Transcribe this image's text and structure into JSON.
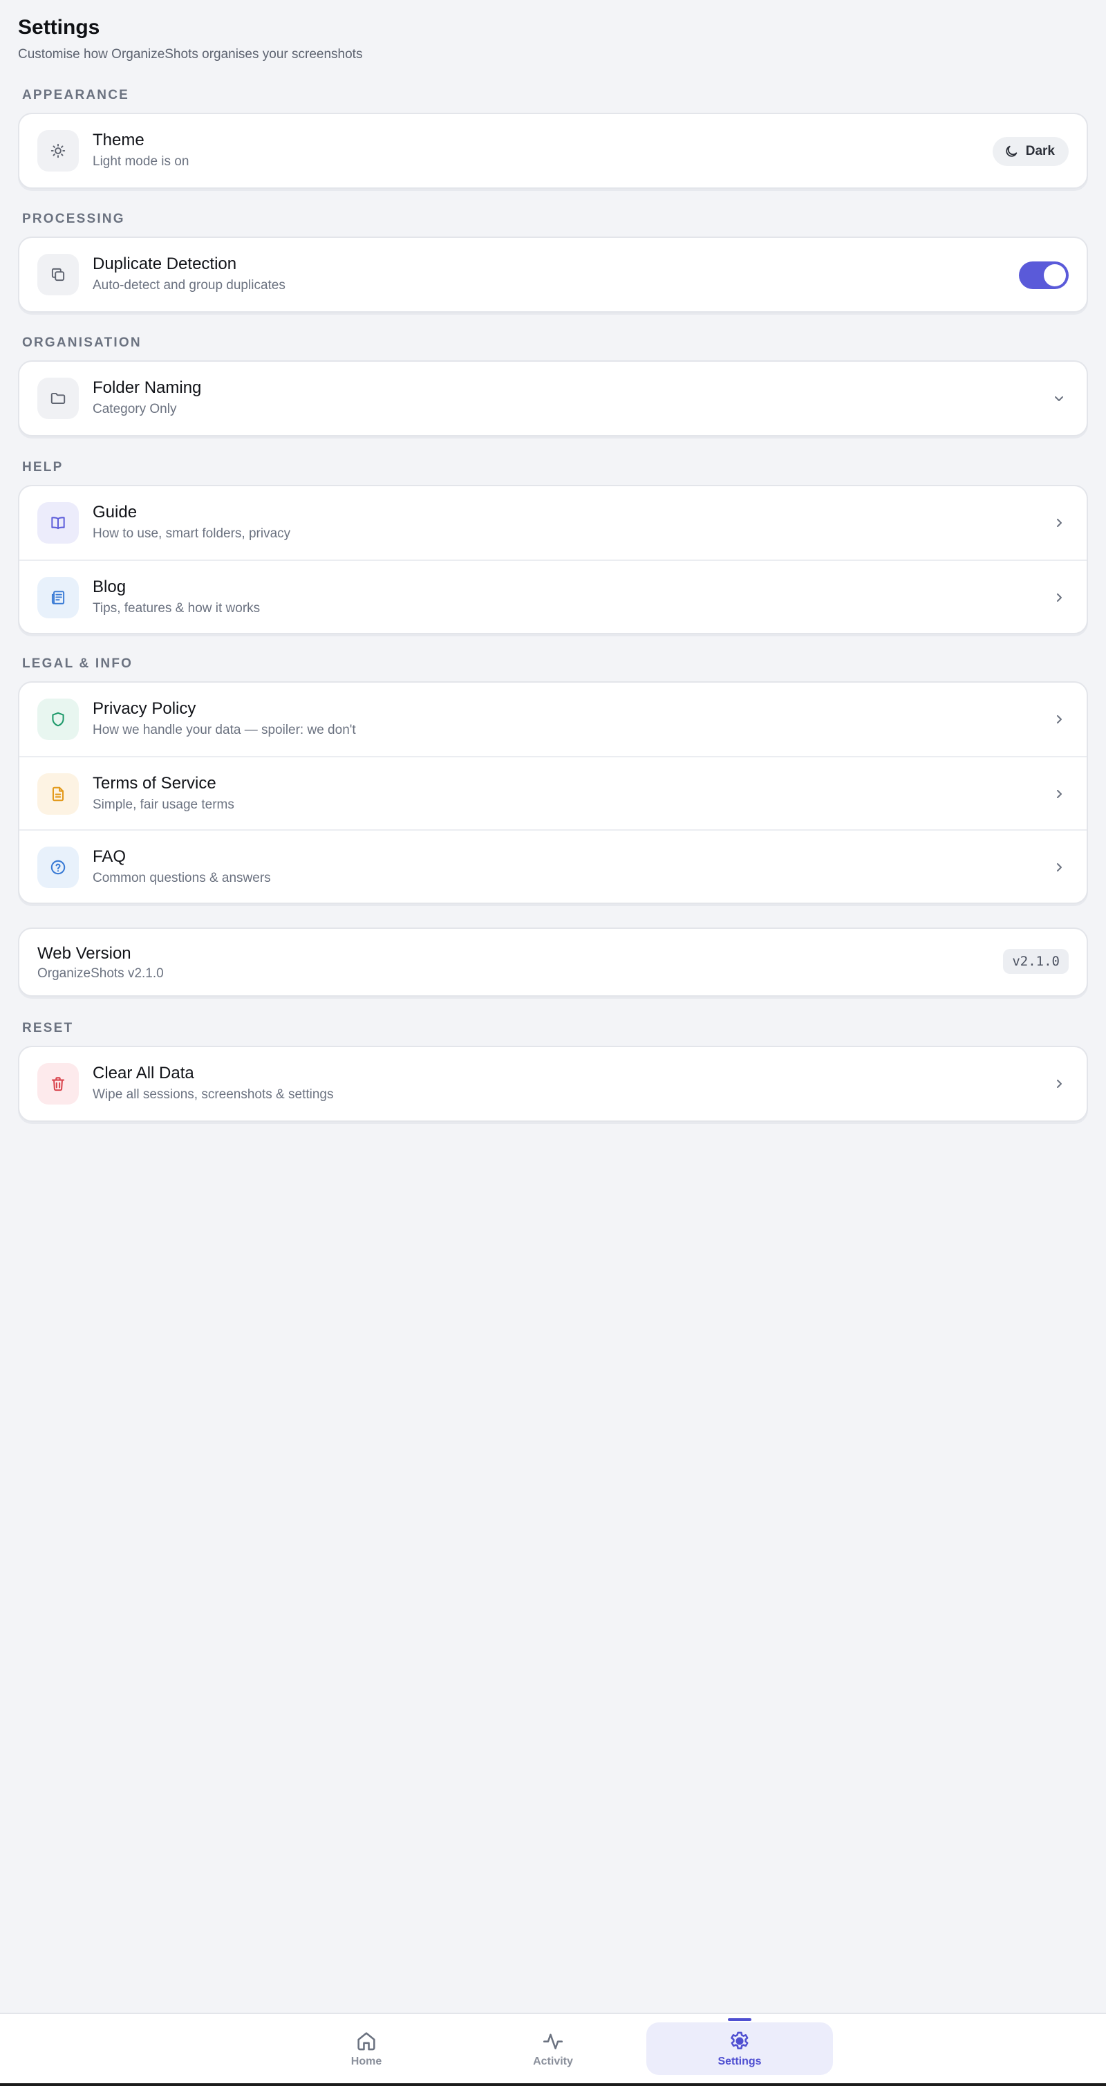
{
  "header": {
    "title": "Settings",
    "subtitle": "Customise how OrganizeShots organises your screenshots"
  },
  "sections": {
    "appearance": {
      "label": "APPEARANCE",
      "theme": {
        "title": "Theme",
        "desc": "Light mode is on",
        "button_label": "Dark",
        "icon": "sun-icon",
        "button_icon": "moon-icon"
      }
    },
    "processing": {
      "label": "PROCESSING",
      "duplicate": {
        "title": "Duplicate Detection",
        "desc": "Auto-detect and group duplicates",
        "enabled": true,
        "icon": "copy-icon"
      }
    },
    "organisation": {
      "label": "ORGANISATION",
      "folder_naming": {
        "title": "Folder Naming",
        "value": "Category Only",
        "icon": "folder-icon"
      }
    },
    "help": {
      "label": "HELP",
      "items": [
        {
          "title": "Guide",
          "desc": "How to use, smart folders, privacy",
          "icon": "book-icon"
        },
        {
          "title": "Blog",
          "desc": "Tips, features & how it works",
          "icon": "newspaper-icon"
        }
      ]
    },
    "legal": {
      "label": "LEGAL & INFO",
      "items": [
        {
          "title": "Privacy Policy",
          "desc": "How we handle your data — spoiler: we don't",
          "icon": "shield-icon"
        },
        {
          "title": "Terms of Service",
          "desc": "Simple, fair usage terms",
          "icon": "document-icon"
        },
        {
          "title": "FAQ",
          "desc": "Common questions & answers",
          "icon": "help-circle-icon"
        }
      ]
    },
    "version": {
      "title": "Web Version",
      "desc": "OrganizeShots v2.1.0",
      "badge": "v2.1.0"
    },
    "reset": {
      "label": "RESET",
      "clear": {
        "title": "Clear All Data",
        "desc": "Wipe all sessions, screenshots & settings",
        "icon": "trash-icon"
      }
    }
  },
  "nav": {
    "items": [
      {
        "label": "Home",
        "icon": "home-icon"
      },
      {
        "label": "Activity",
        "icon": "activity-icon"
      },
      {
        "label": "Settings",
        "icon": "gear-icon"
      }
    ],
    "active": "Settings"
  },
  "colors": {
    "accent": "#5a5ad9",
    "background": "#f3f4f7",
    "danger": "#d9434c",
    "privacy": "#1f9a6b",
    "terms": "#e39a1c",
    "faq": "#3a7bd5"
  }
}
